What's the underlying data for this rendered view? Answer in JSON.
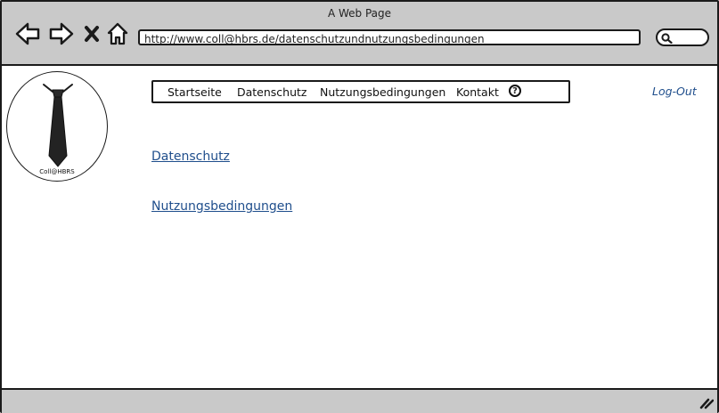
{
  "window": {
    "title": "A Web Page"
  },
  "browser": {
    "url": "http://www.coll@hbrs.de/datenschutzundnutzungsbedingungen",
    "icons": [
      "back-arrow-icon",
      "forward-arrow-icon",
      "close-x-icon",
      "home-icon",
      "search-icon",
      "resize-grip-icon"
    ]
  },
  "logo": {
    "text": "Coll@HBRS",
    "icon": "necktie-icon"
  },
  "nav": {
    "items": [
      {
        "label": "Startseite"
      },
      {
        "label": "Datenschutz"
      },
      {
        "label": "Nutzungsbedingungen"
      },
      {
        "label": "Kontakt"
      }
    ],
    "help_label": "?"
  },
  "header": {
    "logout_label": "Log-Out"
  },
  "content": {
    "links": [
      {
        "label": "Datenschutz"
      },
      {
        "label": "Nutzungsbedingungen"
      }
    ]
  },
  "colors": {
    "chrome": "#c9c9c9",
    "link": "#1f4e8c",
    "border": "#1a1a1a"
  }
}
